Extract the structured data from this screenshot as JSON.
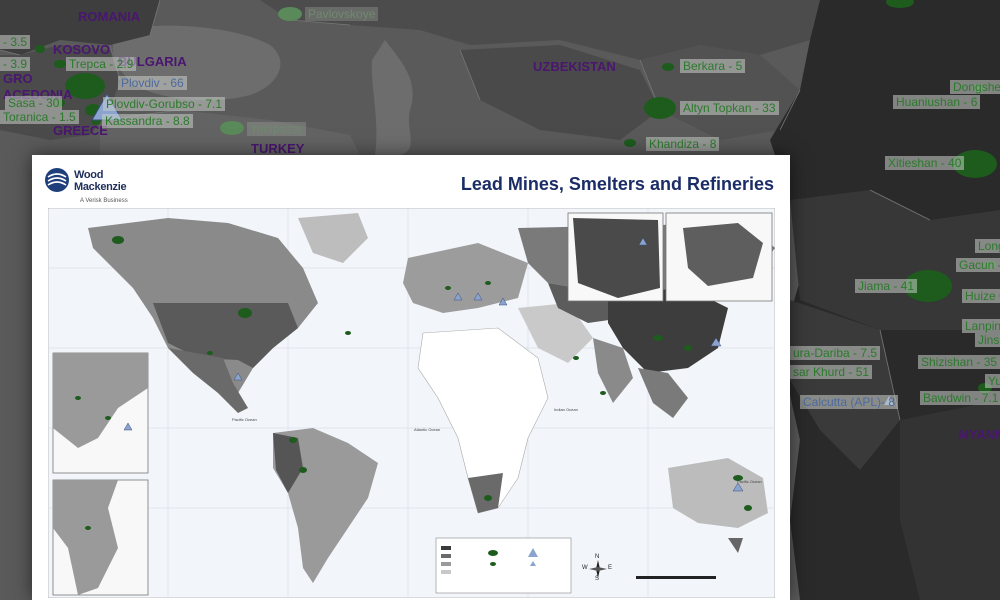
{
  "background_map": {
    "country_labels": [
      "ROMANIA",
      "KOSOVO",
      "BULGARIA",
      "UZBEKISTAN",
      "GREECE",
      "TURKEY",
      "MYANM",
      "GRO",
      "ACEDONIA"
    ],
    "site_labels": [
      {
        "text": "Pavlovskoye",
        "kind": "dim"
      },
      {
        "text": "- 3.5",
        "kind": "mine"
      },
      {
        "text": "- 3.9",
        "kind": "mine"
      },
      {
        "text": "Trepca - 2.9",
        "kind": "mine"
      },
      {
        "text": "Plovdiv - 66",
        "kind": "refinery"
      },
      {
        "text": "Sasa - 30",
        "kind": "mine"
      },
      {
        "text": "Plovdiv-Gorubso - 7.1",
        "kind": "mine"
      },
      {
        "text": "Toranica - 1.5",
        "kind": "mine"
      },
      {
        "text": "Kassandra - 8.8",
        "kind": "mine"
      },
      {
        "text": "Yenipazar",
        "kind": "dim"
      },
      {
        "text": "Berkara - 5",
        "kind": "mine"
      },
      {
        "text": "Altyn Topkan - 33",
        "kind": "mine"
      },
      {
        "text": "Khandiza - 8",
        "kind": "mine"
      },
      {
        "text": "Dongshen",
        "kind": "mine"
      },
      {
        "text": "Huaniushan - 6",
        "kind": "mine"
      },
      {
        "text": "Xitieshan - 40",
        "kind": "mine"
      },
      {
        "text": "Long",
        "kind": "mine"
      },
      {
        "text": "Gacun -",
        "kind": "mine"
      },
      {
        "text": "Jiama - 41",
        "kind": "mine"
      },
      {
        "text": "Huize G",
        "kind": "mine"
      },
      {
        "text": "Lanping",
        "kind": "mine"
      },
      {
        "text": "Jinsh",
        "kind": "mine"
      },
      {
        "text": "ura-Dariba - 7.5",
        "kind": "mine"
      },
      {
        "text": "Shizishan - 35",
        "kind": "mine"
      },
      {
        "text": "sar Khurd - 51",
        "kind": "mine"
      },
      {
        "text": "Yu",
        "kind": "mine"
      },
      {
        "text": "Calcutta (APL)- 8",
        "kind": "refinery"
      },
      {
        "text": "Bawdwin - 7.1",
        "kind": "mine"
      }
    ]
  },
  "poster": {
    "title": "Lead Mines, Smelters and Refineries",
    "logo": {
      "line1": "Wood",
      "line2": "Mackenzie",
      "tagline": "A Verisk Business"
    },
    "ocean_labels": [
      "Pacific Ocean",
      "Atlantic Ocean",
      "Indian Ocean",
      "Pacific Ocean"
    ],
    "compass": [
      "N",
      "S",
      "W",
      "E"
    ]
  },
  "colors": {
    "mine_green": "#1d5c1d",
    "refinery_blue": "#8aa4cf",
    "poster_title": "#1b2d66",
    "country_purple": "#4a1670"
  }
}
